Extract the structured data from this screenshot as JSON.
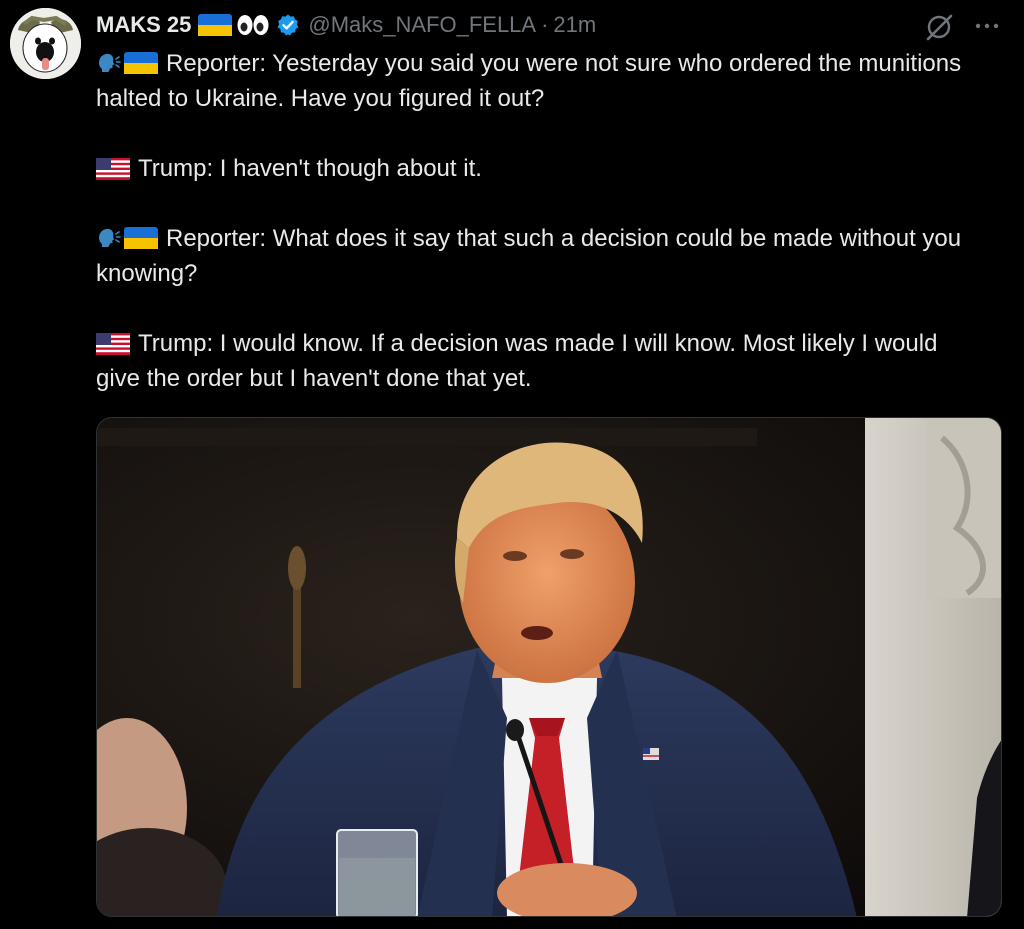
{
  "author": {
    "display_name": "MAKS 25",
    "handle": "@Maks_NAFO_FELLA",
    "separator": "·",
    "time": "21m",
    "name_emojis": [
      "ukraine-flag",
      "eyes"
    ],
    "verified_color": "#1d9bf0"
  },
  "actions": {
    "grok_icon": "grok-icon",
    "more_icon": "more-icon"
  },
  "tweet": {
    "lines": [
      {
        "speaker_icons": [
          "speaking-head",
          "ukraine-flag"
        ],
        "text": "Reporter: Yesterday you said you were not sure who ordered the munitions halted to Ukraine. Have you figured it out?"
      },
      {
        "speaker_icons": [
          "us-flag"
        ],
        "text": "Trump: I haven't though about it."
      },
      {
        "speaker_icons": [
          "speaking-head",
          "ukraine-flag"
        ],
        "text": "Reporter: What does it say that such a decision could be made without you knowing?"
      },
      {
        "speaker_icons": [
          "us-flag"
        ],
        "text": "Trump: I would know. If a decision was made I will know. Most likely I would give the order but I haven't done that yet."
      }
    ]
  },
  "media": {
    "kind": "photo"
  },
  "colors": {
    "background": "#000000",
    "text": "#e7e9ea",
    "muted": "#71767b",
    "border": "#2f3336"
  }
}
